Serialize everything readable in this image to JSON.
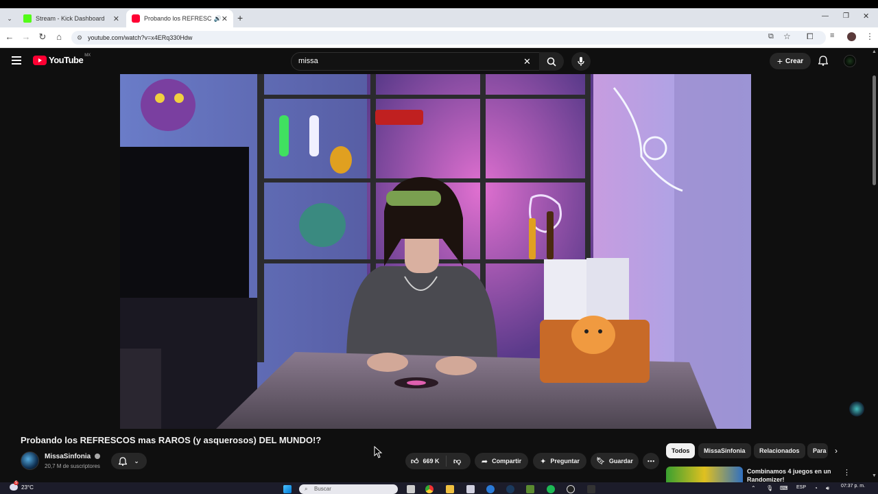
{
  "browser": {
    "tabs": [
      {
        "title": "Stream - Kick Dashboard",
        "favicon_color": "#53fc18",
        "active": false
      },
      {
        "title": "Probando los REFRESCOS m",
        "favicon_color": "#ff0033",
        "active": true
      }
    ],
    "url": "youtube.com/watch?v=x4ERq330Hdw"
  },
  "youtube": {
    "logo_text": "YouTube",
    "country": "MX",
    "search_value": "missa",
    "create_label": "Crear"
  },
  "video": {
    "title": "Probando los REFRESCOS mas RAROS (y asquerosos) DEL MUNDO!?",
    "channel": "MissaSinfonia",
    "subscribers": "20,7 M de suscriptores",
    "likes": "669 K",
    "share_label": "Compartir",
    "ask_label": "Preguntar",
    "save_label": "Guardar"
  },
  "chips": [
    "Todos",
    "MissaSinfonia",
    "Relacionados",
    "Para"
  ],
  "recommended": {
    "title": "Combinamos 4 juegos en un Randomizer!"
  },
  "taskbar": {
    "weather_temp": "23°C",
    "weather_badge": "5",
    "search_placeholder": "Buscar",
    "lang": "ESP",
    "time": "07:37 p. m."
  },
  "colors": {
    "yt_red": "#ff0033",
    "bg": "#0f0f0f",
    "chip_selected": "#f1f1f1"
  }
}
